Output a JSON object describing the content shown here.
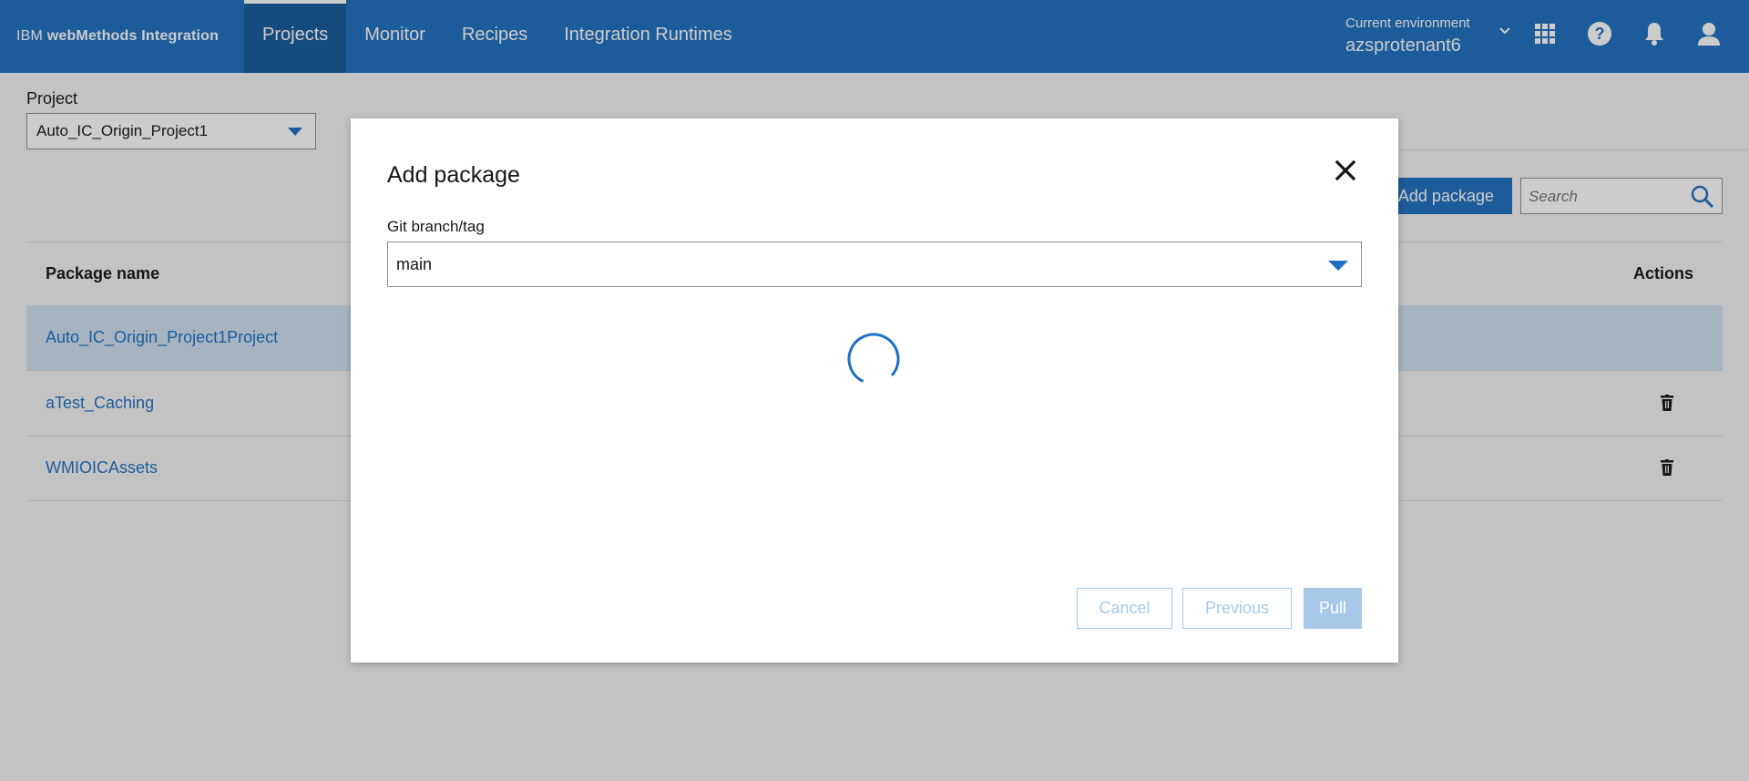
{
  "header": {
    "brand_ibm": "IBM",
    "brand_product": "webMethods Integration",
    "nav": [
      {
        "label": "Projects",
        "active": true
      },
      {
        "label": "Monitor",
        "active": false
      },
      {
        "label": "Recipes",
        "active": false
      },
      {
        "label": "Integration Runtimes",
        "active": false
      }
    ],
    "env_label": "Current environment",
    "env_value": "azsprotenant6",
    "icons": [
      "chevron-down-icon",
      "app-switcher-icon",
      "help-icon",
      "notification-bell-icon",
      "user-avatar-icon"
    ]
  },
  "page": {
    "project_label": "Project",
    "project_value": "Auto_IC_Origin_Project1",
    "add_package_label": "Add package",
    "search_placeholder": "Search",
    "table": {
      "col_name": "Package name",
      "col_actions": "Actions",
      "rows": [
        {
          "name": "Auto_IC_Origin_Project1Project",
          "selected": true,
          "deletable": false
        },
        {
          "name": "aTest_Caching",
          "selected": false,
          "deletable": true
        },
        {
          "name": "WMIOICAssets",
          "selected": false,
          "deletable": true
        }
      ]
    }
  },
  "modal": {
    "title": "Add package",
    "branch_label": "Git branch/tag",
    "branch_value": "main",
    "loading": true,
    "buttons": {
      "cancel": "Cancel",
      "previous": "Previous",
      "pull": "Pull"
    }
  },
  "colors": {
    "brand_blue": "#1f70c1",
    "active_nav": "#165a9c",
    "selected_row": "#cfe0f3",
    "disabled_button": "#a8c8ea"
  }
}
